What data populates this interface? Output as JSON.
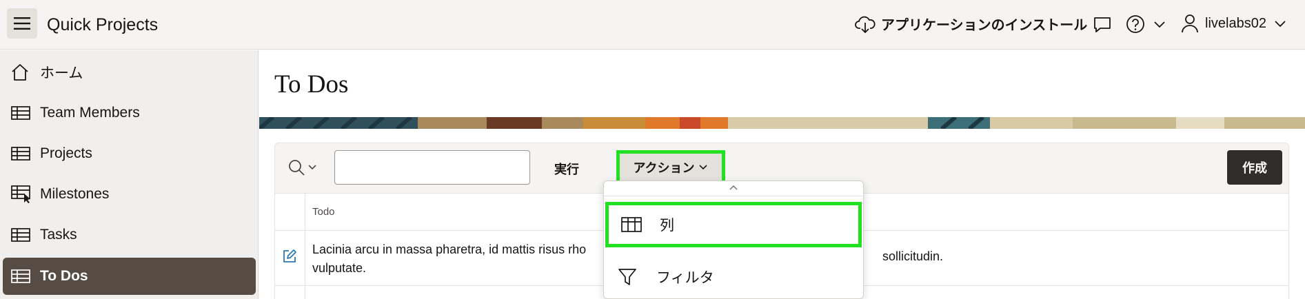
{
  "header": {
    "app_title": "Quick Projects",
    "install_label": "アプリケーションのインストール",
    "user_name": "livelabs02"
  },
  "sidebar": {
    "items": [
      {
        "label": "ホーム",
        "icon": "home-icon"
      },
      {
        "label": "Team Members",
        "icon": "table-icon"
      },
      {
        "label": "Projects",
        "icon": "table-icon"
      },
      {
        "label": "Milestones",
        "icon": "table-cursor-icon"
      },
      {
        "label": "Tasks",
        "icon": "table-icon"
      },
      {
        "label": "To Dos",
        "icon": "table-icon",
        "active": true
      }
    ]
  },
  "main": {
    "page_title": "To Dos",
    "toolbar": {
      "search_value": "",
      "go_label": "実行",
      "actions_label": "アクション",
      "create_label": "作成"
    },
    "table": {
      "columns": [
        "Todo"
      ],
      "rows": [
        {
          "todo_part1": "Lacinia arcu in massa pharetra, id mattis risus rho",
          "todo_part2": "sollicitudin.",
          "todo_line2": "vulputate."
        }
      ]
    }
  },
  "actions_menu": {
    "items": [
      {
        "label": "列",
        "icon": "columns-icon",
        "highlighted": true
      },
      {
        "label": "フィルタ",
        "icon": "filter-icon"
      }
    ]
  },
  "colors": {
    "active_nav": "#574c43",
    "highlight": "#22e022",
    "create_button": "#312d2a"
  }
}
